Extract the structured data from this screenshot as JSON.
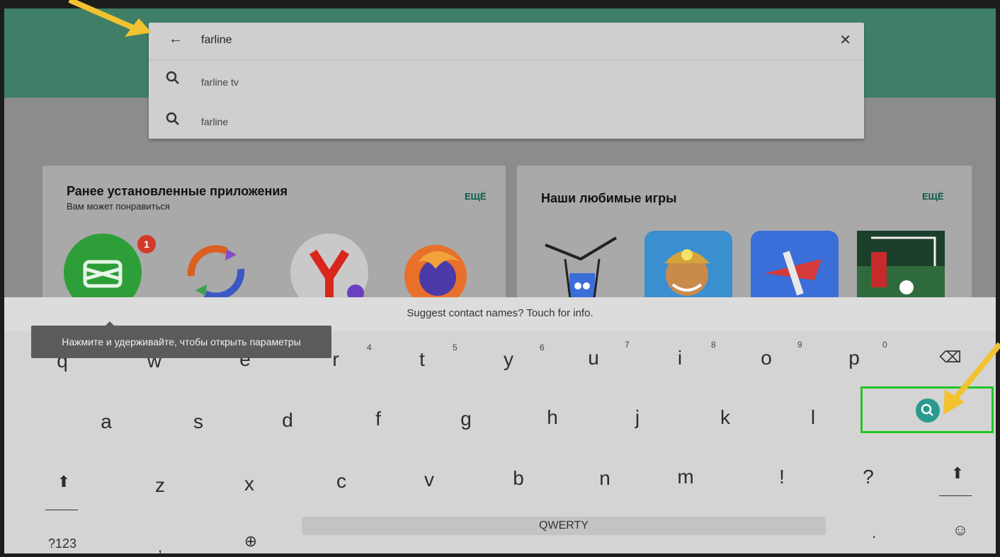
{
  "search": {
    "query": "farline",
    "suggestions": [
      "farline tv",
      "farline"
    ]
  },
  "cards": [
    {
      "title": "Ранее установленные приложения",
      "subtitle": "Вам может понравиться",
      "more_label": "ЕЩЁ",
      "items": [
        {
          "icon": "map-app-icon",
          "badge": "1"
        },
        {
          "icon": "sync-arrows-app-icon"
        },
        {
          "icon": "yandex-app-icon"
        },
        {
          "icon": "firefox-app-icon"
        }
      ]
    },
    {
      "title": "Наши любимые игры",
      "more_label": "ЕЩЁ",
      "items": [
        {
          "icon": "drawing-game-icon"
        },
        {
          "icon": "miner-game-icon"
        },
        {
          "icon": "plane-game-icon"
        },
        {
          "icon": "soccer-game-icon"
        }
      ]
    }
  ],
  "keyboard": {
    "suggestion_strip": "Suggest contact names? Touch for info.",
    "tooltip": "Нажмите и удерживайте, чтобы открыть параметры",
    "row1": [
      "q",
      "w",
      "e",
      "r",
      "t",
      "y",
      "u",
      "i",
      "o",
      "p"
    ],
    "row1_hints": [
      "4",
      "5",
      "6",
      "7",
      "8",
      "9",
      "0"
    ],
    "row2": [
      "a",
      "s",
      "d",
      "f",
      "g",
      "h",
      "j",
      "k",
      "l"
    ],
    "row3": [
      "z",
      "x",
      "c",
      "v",
      "b",
      "n",
      "m",
      "!",
      "?"
    ],
    "symbols_key": "?123",
    "comma_key": ",",
    "space_label": "QWERTY",
    "period_key": ".",
    "icons": {
      "backspace": "backspace-icon",
      "search": "search-action-icon",
      "shift": "shift-icon",
      "globe": "globe-icon",
      "emoji": "emoji-icon"
    }
  },
  "colors": {
    "appbar": "#3f7f68",
    "search_action": "#2a9a8f",
    "highlight": "#22c622",
    "annotation_arrow": "#f2c230"
  }
}
